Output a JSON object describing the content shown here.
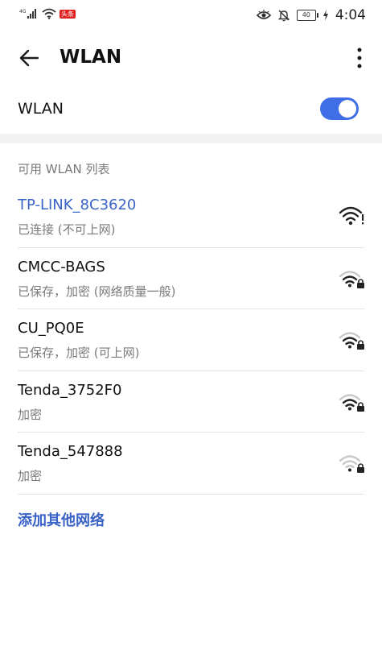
{
  "status_bar": {
    "network_type": "4G",
    "news_badge": "头条",
    "battery": "40",
    "time": "4:04"
  },
  "header": {
    "title": "WLAN"
  },
  "wlan_toggle": {
    "label": "WLAN",
    "state": "on"
  },
  "networks": {
    "section_title": "可用 WLAN 列表",
    "items": [
      {
        "ssid": "TP-LINK_8C3620",
        "status": "已连接 (不可上网)",
        "connected": true,
        "secured": false,
        "signal_bars": 4,
        "warning": true
      },
      {
        "ssid": "CMCC-BAGS",
        "status": "已保存，加密 (网络质量一般)",
        "connected": false,
        "secured": true,
        "signal_bars": 3
      },
      {
        "ssid": "CU_PQ0E",
        "status": "已保存，加密 (可上网)",
        "connected": false,
        "secured": true,
        "signal_bars": 3
      },
      {
        "ssid": "Tenda_3752F0",
        "status": "加密",
        "connected": false,
        "secured": true,
        "signal_bars": 3
      },
      {
        "ssid": "Tenda_547888",
        "status": "加密",
        "connected": false,
        "secured": true,
        "signal_bars": 1
      }
    ]
  },
  "add_network": {
    "label": "添加其他网络"
  },
  "colors": {
    "accent": "#3f6ee6",
    "link": "#3a63c6",
    "secondary_text": "#7a7a7a",
    "band": "#f1f1f1"
  }
}
